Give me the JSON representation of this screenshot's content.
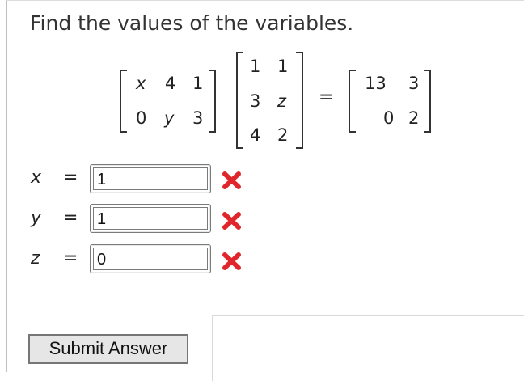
{
  "prompt": "Find the values of the variables.",
  "matrix_a": [
    [
      "x",
      "4",
      "1"
    ],
    [
      "0",
      "y",
      "3"
    ]
  ],
  "matrix_b": [
    [
      "1",
      "1"
    ],
    [
      "3",
      "z"
    ],
    [
      "4",
      "2"
    ]
  ],
  "equals": "=",
  "matrix_c": [
    [
      "13",
      "3"
    ],
    [
      "0",
      "2"
    ]
  ],
  "answers": [
    {
      "variable": "x",
      "equals": "=",
      "value": "1",
      "status": "incorrect"
    },
    {
      "variable": "y",
      "equals": "=",
      "value": "1",
      "status": "incorrect"
    },
    {
      "variable": "z",
      "equals": "=",
      "value": "0",
      "status": "incorrect"
    }
  ],
  "submit_label": "Submit Answer",
  "colors": {
    "incorrect": "#e0262b"
  },
  "icons": {
    "incorrect": "x-mark-icon"
  }
}
